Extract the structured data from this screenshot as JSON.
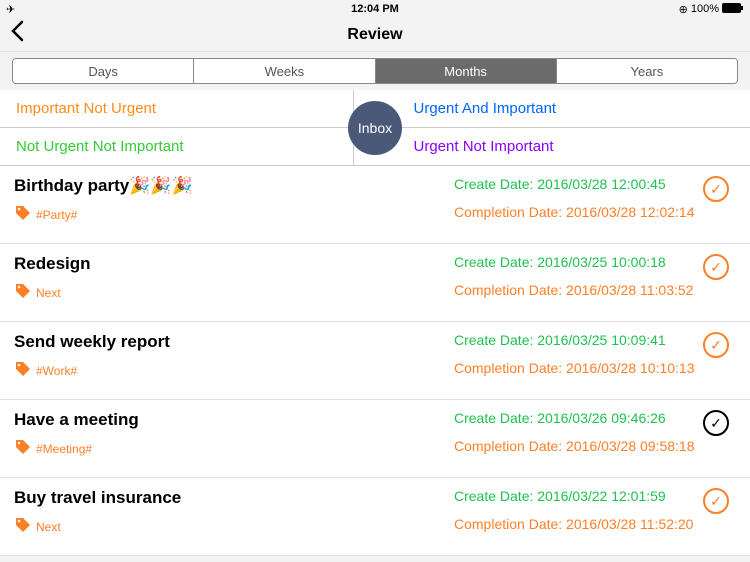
{
  "status": {
    "time": "12:04 PM",
    "battery": "100%"
  },
  "nav": {
    "title": "Review"
  },
  "segments": [
    {
      "label": "Days",
      "active": false
    },
    {
      "label": "Weeks",
      "active": false
    },
    {
      "label": "Months",
      "active": true
    },
    {
      "label": "Years",
      "active": false
    }
  ],
  "quadrant": {
    "tl": "Important Not Urgent",
    "tr": "Urgent And Important",
    "bl": "Not Urgent Not Important",
    "br": "Urgent Not Important",
    "inbox": "Inbox"
  },
  "tasks": [
    {
      "title": "Birthday party🎉🎉🎉",
      "tag": "#Party#",
      "create": "Create Date: 2016/03/28 12:00:45",
      "complete": "Completion Date: 2016/03/28 12:02:14",
      "style": "orange"
    },
    {
      "title": "Redesign",
      "tag": "Next",
      "create": "Create Date: 2016/03/25 10:00:18",
      "complete": "Completion Date: 2016/03/28 11:03:52",
      "style": "orange"
    },
    {
      "title": "Send weekly report",
      "tag": "#Work#",
      "create": "Create Date: 2016/03/25 10:09:41",
      "complete": "Completion Date: 2016/03/28 10:10:13",
      "style": "orange"
    },
    {
      "title": "Have a meeting",
      "tag": "#Meeting#",
      "create": "Create Date: 2016/03/26 09:46:26",
      "complete": "Completion Date: 2016/03/28 09:58:18",
      "style": "black"
    },
    {
      "title": "Buy travel insurance",
      "tag": "Next",
      "create": "Create Date: 2016/03/22 12:01:59",
      "complete": "Completion Date: 2016/03/28 11:52:20",
      "style": "orange"
    }
  ]
}
